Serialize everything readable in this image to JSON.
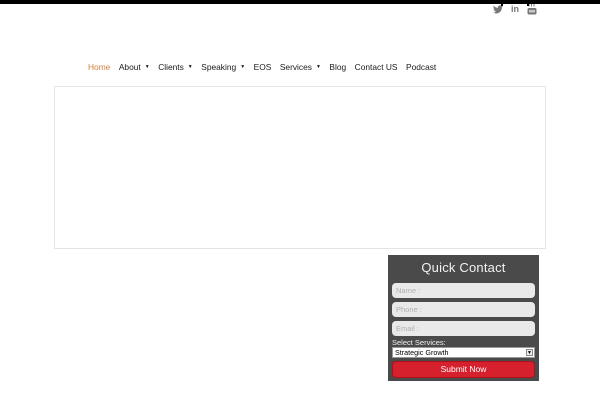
{
  "social": [
    {
      "name": "twitter",
      "icon": "twitter-icon"
    },
    {
      "name": "linkedin",
      "icon": "linkedin-icon",
      "text": "in"
    },
    {
      "name": "youtube",
      "icon": "youtube-icon"
    }
  ],
  "nav": [
    {
      "label": "Home",
      "active": true,
      "dropdown": false
    },
    {
      "label": "About",
      "active": false,
      "dropdown": true
    },
    {
      "label": "Clients",
      "active": false,
      "dropdown": true
    },
    {
      "label": "Speaking",
      "active": false,
      "dropdown": true
    },
    {
      "label": "EOS",
      "active": false,
      "dropdown": false
    },
    {
      "label": "Services",
      "active": false,
      "dropdown": true
    },
    {
      "label": "Blog",
      "active": false,
      "dropdown": false
    },
    {
      "label": "Contact US",
      "active": false,
      "dropdown": false
    },
    {
      "label": "Podcast",
      "active": false,
      "dropdown": false
    }
  ],
  "colors": {
    "active_nav": "#d3803a",
    "panel_bg": "#4a4a4a",
    "submit_bg": "#d6202d"
  },
  "quick_contact": {
    "title": "Quick Contact",
    "name_placeholder": "Name :",
    "phone_placeholder": "Phone :",
    "email_placeholder": "Email :",
    "services_label": "Select Services:",
    "services_selected": "Strategic Growth",
    "submit_label": "Submit Now"
  }
}
